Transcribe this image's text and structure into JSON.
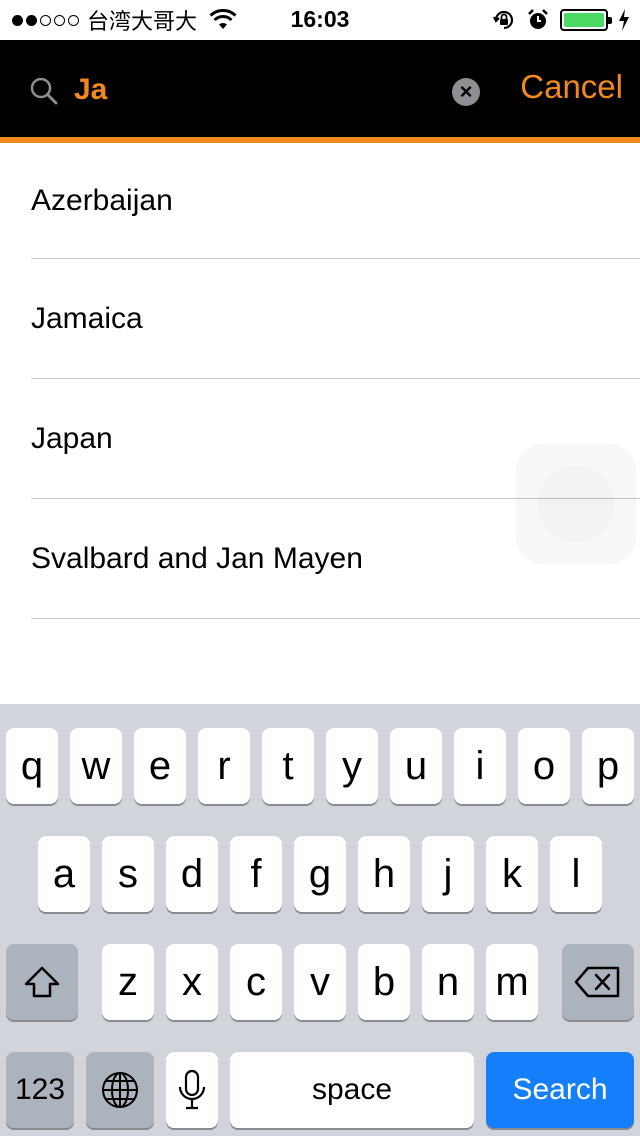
{
  "status_bar": {
    "carrier": "台湾大哥大",
    "time": "16:03"
  },
  "search": {
    "value": "Ja",
    "cancel_label": "Cancel",
    "clear_symbol": "×"
  },
  "results": [
    {
      "label": "Azerbaijan"
    },
    {
      "label": "Jamaica"
    },
    {
      "label": "Japan"
    },
    {
      "label": "Svalbard and Jan Mayen"
    }
  ],
  "keyboard": {
    "row1": [
      "q",
      "w",
      "e",
      "r",
      "t",
      "y",
      "u",
      "i",
      "o",
      "p"
    ],
    "row2": [
      "a",
      "s",
      "d",
      "f",
      "g",
      "h",
      "j",
      "k",
      "l"
    ],
    "row3": [
      "z",
      "x",
      "c",
      "v",
      "b",
      "n",
      "m"
    ],
    "numbers_label": "123",
    "space_label": "space",
    "search_label": "Search"
  },
  "colors": {
    "accent": "#f2891d",
    "header_bg": "#000000",
    "search_key": "#147efb",
    "keyboard_bg": "#d1d5db"
  },
  "icons": [
    "search-icon",
    "clear-icon",
    "wifi-icon",
    "rotation-lock-icon",
    "alarm-icon",
    "battery-icon",
    "shift-icon",
    "delete-icon",
    "globe-icon",
    "microphone-icon"
  ]
}
